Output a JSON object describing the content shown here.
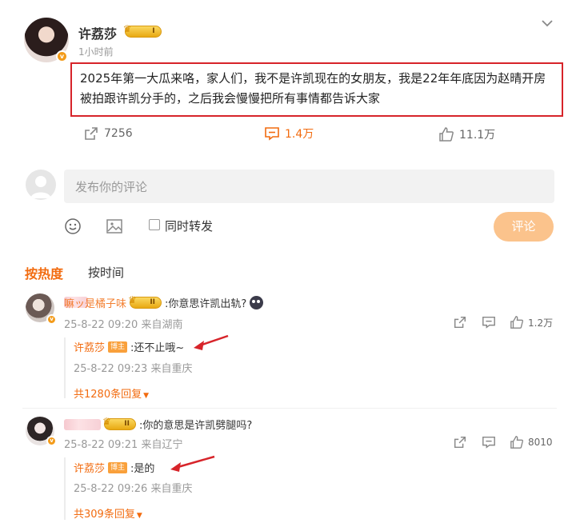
{
  "post": {
    "author": "许荔莎",
    "level": "I",
    "time": "1小时前",
    "text": "2025年第一大瓜来咯，家人们，我不是许凯现在的女朋友，我是22年年底因为赵晴开房被拍跟许凯分手的，之后我会慢慢把所有事情都告诉大家",
    "verified_mark": "v",
    "actions": {
      "share_count": "7256",
      "comment_count": "1.4万",
      "like_count": "11.1万"
    }
  },
  "composer": {
    "placeholder": "发布你的评论",
    "forward_label": "同时转发",
    "submit_label": "评论"
  },
  "sort": {
    "hot": "按热度",
    "time": "按时间"
  },
  "comments": [
    {
      "author_visible": "嘛ッ是橘子味",
      "level": "II",
      "text": ":你意思许凯出轨?",
      "meta": "25-8-22 09:20 来自湖南",
      "like_count": "1.2万",
      "reply": {
        "author": "许荔莎",
        "badge": "博主",
        "text": ":还不止哦~",
        "meta": "25-8-22 09:23 来自重庆"
      },
      "more": "共1280条回复"
    },
    {
      "author_visible": "",
      "level": "II",
      "text": ":你的意思是许凯劈腿吗?",
      "meta": "25-8-22 09:21 来自辽宁",
      "like_count": "8010",
      "reply": {
        "author": "许荔莎",
        "badge": "博主",
        "text": ":是的",
        "meta": "25-8-22 09:26 来自重庆"
      },
      "more": "共309条回复"
    }
  ],
  "colors": {
    "accent": "#f26b0f",
    "highlight_border": "#d7242a",
    "submit_bg": "#fbc38c",
    "arrow": "#d7242a"
  }
}
